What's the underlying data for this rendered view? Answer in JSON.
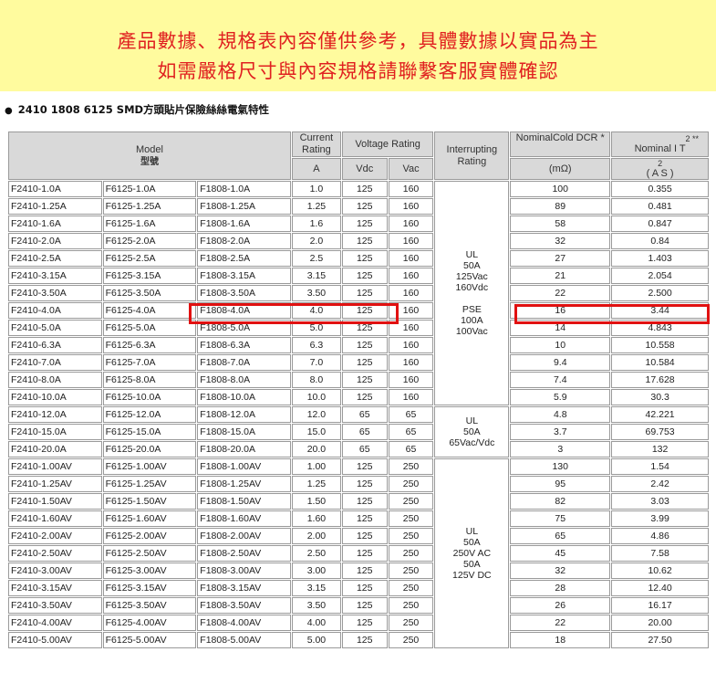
{
  "banner": {
    "line1": "產品數據、規格表內容僅供參考，具體數據以實品為主",
    "line2": "如需嚴格尺寸與內容規格請聯繫客服實體確認"
  },
  "heading": {
    "bullet": "●",
    "text": "2410 1808 6125 SMD方頭貼片保險絲絲電氣特性"
  },
  "table": {
    "headers": {
      "model": "Model",
      "model_cn": "型號",
      "current": "Current Rating",
      "current_unit": "A",
      "voltage": "Voltage Rating",
      "vdc": "Vdc",
      "vac": "Vac",
      "interrupting": "Interrupting Rating",
      "dcr": "NominalCold DCR *",
      "dcr_unit": "(mΩ)",
      "i2t_top": "2 **",
      "i2t_mid": "Nominal I T",
      "i2t_bot1": "2",
      "i2t_bot2": "( A S )"
    },
    "interrupting_groups": [
      "UL\n50A\n125Vac\n160Vdc\n\nPSE\n100A\n100Vac",
      "UL\n50A\n65Vac/Vdc",
      "UL\n50A\n250V AC\n50A\n125V DC"
    ],
    "rows": [
      [
        "F2410-1.0A",
        "F6125-1.0A",
        "F1808-1.0A",
        "1.0",
        "125",
        "160",
        "100",
        "0.355"
      ],
      [
        "F2410-1.25A",
        "F6125-1.25A",
        "F1808-1.25A",
        "1.25",
        "125",
        "160",
        "89",
        "0.481"
      ],
      [
        "F2410-1.6A",
        "F6125-1.6A",
        "F1808-1.6A",
        "1.6",
        "125",
        "160",
        "58",
        "0.847"
      ],
      [
        "F2410-2.0A",
        "F6125-2.0A",
        "F1808-2.0A",
        "2.0",
        "125",
        "160",
        "32",
        "0.84"
      ],
      [
        "F2410-2.5A",
        "F6125-2.5A",
        "F1808-2.5A",
        "2.5",
        "125",
        "160",
        "27",
        "1.403"
      ],
      [
        "F2410-3.15A",
        "F6125-3.15A",
        "F1808-3.15A",
        "3.15",
        "125",
        "160",
        "21",
        "2.054"
      ],
      [
        "F2410-3.50A",
        "F6125-3.50A",
        "F1808-3.50A",
        "3.50",
        "125",
        "160",
        "22",
        "2.500"
      ],
      [
        "F2410-4.0A",
        "F6125-4.0A",
        "F1808-4.0A",
        "4.0",
        "125",
        "160",
        "16",
        "3.44"
      ],
      [
        "F2410-5.0A",
        "F6125-5.0A",
        "F1808-5.0A",
        "5.0",
        "125",
        "160",
        "14",
        "4.843"
      ],
      [
        "F2410-6.3A",
        "F6125-6.3A",
        "F1808-6.3A",
        "6.3",
        "125",
        "160",
        "10",
        "10.558"
      ],
      [
        "F2410-7.0A",
        "F6125-7.0A",
        "F1808-7.0A",
        "7.0",
        "125",
        "160",
        "9.4",
        "10.584"
      ],
      [
        "F2410-8.0A",
        "F6125-8.0A",
        "F1808-8.0A",
        "8.0",
        "125",
        "160",
        "7.4",
        "17.628"
      ],
      [
        "F2410-10.0A",
        "F6125-10.0A",
        "F1808-10.0A",
        "10.0",
        "125",
        "160",
        "5.9",
        "30.3"
      ],
      [
        "F2410-12.0A",
        "F6125-12.0A",
        "F1808-12.0A",
        "12.0",
        "65",
        "65",
        "4.8",
        "42.221"
      ],
      [
        "F2410-15.0A",
        "F6125-15.0A",
        "F1808-15.0A",
        "15.0",
        "65",
        "65",
        "3.7",
        "69.753"
      ],
      [
        "F2410-20.0A",
        "F6125-20.0A",
        "F1808-20.0A",
        "20.0",
        "65",
        "65",
        "3",
        "132"
      ],
      [
        "F2410-1.00AV",
        "F6125-1.00AV",
        "F1808-1.00AV",
        "1.00",
        "125",
        "250",
        "130",
        "1.54"
      ],
      [
        "F2410-1.25AV",
        "F6125-1.25AV",
        "F1808-1.25AV",
        "1.25",
        "125",
        "250",
        "95",
        "2.42"
      ],
      [
        "F2410-1.50AV",
        "F6125-1.50AV",
        "F1808-1.50AV",
        "1.50",
        "125",
        "250",
        "82",
        "3.03"
      ],
      [
        "F2410-1.60AV",
        "F6125-1.60AV",
        "F1808-1.60AV",
        "1.60",
        "125",
        "250",
        "75",
        "3.99"
      ],
      [
        "F2410-2.00AV",
        "F6125-2.00AV",
        "F1808-2.00AV",
        "2.00",
        "125",
        "250",
        "65",
        "4.86"
      ],
      [
        "F2410-2.50AV",
        "F6125-2.50AV",
        "F1808-2.50AV",
        "2.50",
        "125",
        "250",
        "45",
        "7.58"
      ],
      [
        "F2410-3.00AV",
        "F6125-3.00AV",
        "F1808-3.00AV",
        "3.00",
        "125",
        "250",
        "32",
        "10.62"
      ],
      [
        "F2410-3.15AV",
        "F6125-3.15AV",
        "F1808-3.15AV",
        "3.15",
        "125",
        "250",
        "28",
        "12.40"
      ],
      [
        "F2410-3.50AV",
        "F6125-3.50AV",
        "F1808-3.50AV",
        "3.50",
        "125",
        "250",
        "26",
        "16.17"
      ],
      [
        "F2410-4.00AV",
        "F6125-4.00AV",
        "F1808-4.00AV",
        "4.00",
        "125",
        "250",
        "22",
        "20.00"
      ],
      [
        "F2410-5.00AV",
        "F6125-5.00AV",
        "F1808-5.00AV",
        "5.00",
        "125",
        "250",
        "18",
        "27.50"
      ]
    ],
    "highlight_color": "#e11111"
  }
}
